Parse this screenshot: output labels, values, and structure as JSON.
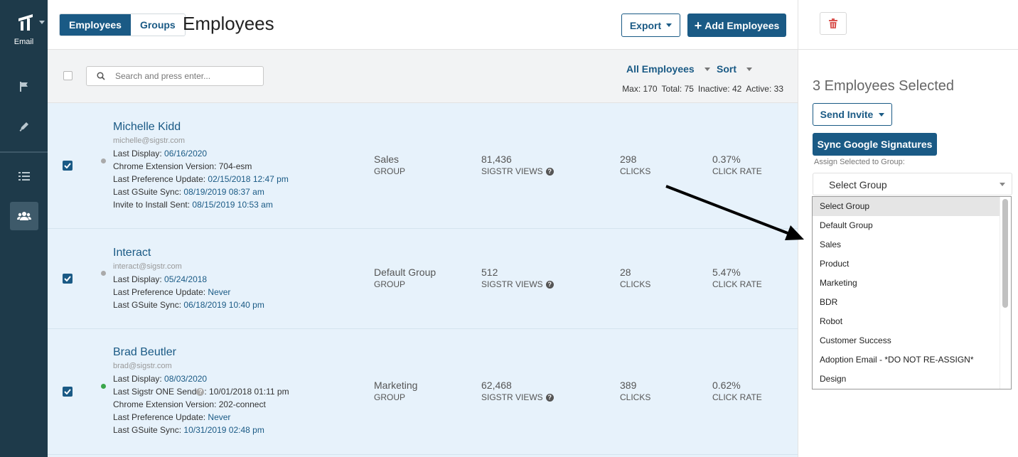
{
  "nav": {
    "logo_label": "Email",
    "icons": [
      "logo-icon",
      "flag-icon",
      "pen-icon",
      "list-icon",
      "users-icon"
    ]
  },
  "header": {
    "tabs": [
      {
        "label": "Employees",
        "active": true
      },
      {
        "label": "Groups",
        "active": false
      }
    ],
    "title": "Employees",
    "export_label": "Export",
    "add_label": "Add Employees"
  },
  "filters": {
    "search_placeholder": "Search and press enter...",
    "view_label": "All Employees",
    "sort_label": "Sort",
    "stats": {
      "max": "Max: 170",
      "total": "Total: 75",
      "inactive": "Inactive: 42",
      "active": "Active: 33"
    }
  },
  "employees": [
    {
      "name": "Michelle Kidd",
      "email": "michelle@sigstr.com",
      "status_color": "#aaaaaa",
      "checked": true,
      "details": [
        {
          "label": "Last Display: ",
          "value": "06/16/2020"
        },
        {
          "label": "Chrome Extension Version: 704-esm",
          "value": ""
        },
        {
          "label": "Last Preference Update: ",
          "value": "02/15/2018 12:47 pm"
        },
        {
          "label": "Last GSuite Sync: ",
          "value": "08/19/2019 08:37 am"
        },
        {
          "label": "Invite to Install Sent: ",
          "value": "08/15/2019 10:53 am"
        }
      ],
      "group": "Sales",
      "group_label": "GROUP",
      "views": "81,436",
      "views_label": "SIGSTR VIEWS",
      "clicks": "298",
      "clicks_label": "CLICKS",
      "rate": "0.37%",
      "rate_label": "CLICK RATE"
    },
    {
      "name": "Interact",
      "email": "interact@sigstr.com",
      "status_color": "#aaaaaa",
      "checked": true,
      "details": [
        {
          "label": "Last Display: ",
          "value": "05/24/2018"
        },
        {
          "label": "Last Preference Update: ",
          "value": "Never"
        },
        {
          "label": "Last GSuite Sync: ",
          "value": "06/18/2019 10:40 pm"
        }
      ],
      "group": "Default Group",
      "group_label": "GROUP",
      "views": "512",
      "views_label": "SIGSTR VIEWS",
      "clicks": "28",
      "clicks_label": "CLICKS",
      "rate": "5.47%",
      "rate_label": "CLICK RATE"
    },
    {
      "name": "Brad Beutler",
      "email": "brad@sigstr.com",
      "status_color": "#3aa64a",
      "checked": true,
      "details": [
        {
          "label": "Last Display: ",
          "value": "08/03/2020"
        },
        {
          "label": "Last Sigstr ONE Send ",
          "value": "",
          "info": ": 10/01/2018 01:11 pm"
        },
        {
          "label": "Chrome Extension Version: 202-connect",
          "value": ""
        },
        {
          "label": "Last Preference Update: ",
          "value": "Never"
        },
        {
          "label": "Last GSuite Sync: ",
          "value": "10/31/2019 02:48 pm"
        }
      ],
      "group": "Marketing",
      "group_label": "GROUP",
      "views": "62,468",
      "views_label": "SIGSTR VIEWS",
      "clicks": "389",
      "clicks_label": "CLICKS",
      "rate": "0.62%",
      "rate_label": "CLICK RATE"
    }
  ],
  "panel": {
    "selected_title": "3 Employees Selected",
    "send_invite_label": "Send Invite",
    "sync_label": "Sync Google Signatures",
    "assign_label": "Assign Selected to Group:",
    "select_value": "Select Group",
    "options": [
      "Select Group",
      "Default Group",
      "Sales",
      "Product",
      "Marketing",
      "BDR",
      "Robot",
      "Customer Success",
      "Adoption Email - *DO NOT RE-ASSIGN*",
      "Design"
    ],
    "highlighted_option": "Select Group"
  },
  "colors": {
    "nav_bg": "#1e3a4a",
    "accent": "#1a5a85",
    "row_selected_bg": "#e7f2fb",
    "danger": "#d9534f"
  }
}
